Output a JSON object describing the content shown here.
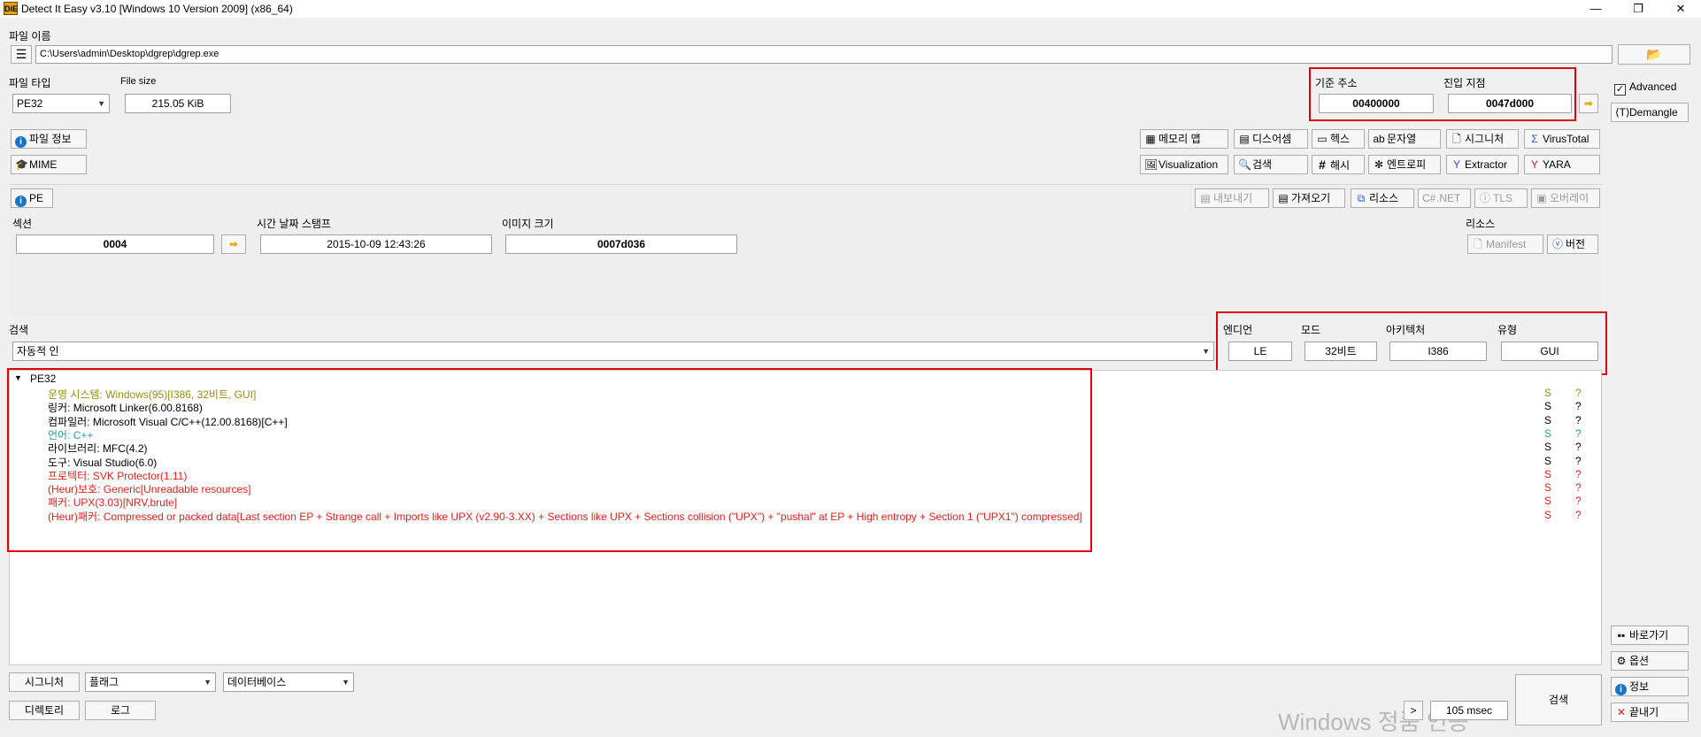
{
  "window": {
    "title": "Detect It Easy v3.10 [Windows 10 Version 2009] (x86_64)",
    "app_icon": "DiE"
  },
  "file": {
    "label": "파일 이름",
    "path": "C:\\Users\\admin\\Desktop\\dgrep\\dgrep.exe"
  },
  "filetype": {
    "label": "파일 타입",
    "value": "PE32"
  },
  "filesize": {
    "label": "File size",
    "value": "215.05 KiB"
  },
  "address": {
    "base_label": "기준 주소",
    "base_value": "00400000",
    "entry_label": "진입 지점",
    "entry_value": "0047d000"
  },
  "side": {
    "advanced": "Advanced",
    "demangle": "Demangle",
    "shortcut": "바로가기",
    "options": "옵션",
    "info": "정보",
    "exit": "끝내기"
  },
  "toolbar": {
    "file_info": "파일 정보",
    "mime": "MIME",
    "memory_map": "메모리 맵",
    "disasm": "디스어셈",
    "hex": "헥스",
    "strings": "문자열",
    "signature": "시그니처",
    "virustotal": "VirusTotal",
    "visualization": "Visualization",
    "search": "검색",
    "hash": "해시",
    "entropy": "엔트로피",
    "extractor": "Extractor",
    "yara": "YARA"
  },
  "pe": {
    "button": "PE",
    "export": "내보내기",
    "import": "가져오기",
    "resource": "리소스",
    "net": ".NET",
    "tls": "TLS",
    "overlay": "오버레이",
    "sections_label": "섹션",
    "sections_value": "0004",
    "timestamp_label": "시간 날짜 스탬프",
    "timestamp_value": "2015-10-09 12:43:26",
    "image_size_label": "이미지 크기",
    "image_size_value": "0007d036",
    "resources_label": "리소스",
    "manifest": "Manifest",
    "version": "버전"
  },
  "scan": {
    "label": "검색",
    "mode": "자동적 인",
    "endian_label": "엔디언",
    "endian_value": "LE",
    "mode_label": "모드",
    "mode_value": "32비트",
    "arch_label": "아키텍처",
    "arch_value": "I386",
    "type_label": "유형",
    "type_value": "GUI"
  },
  "results": {
    "root": "PE32",
    "items": [
      {
        "prefix": "운영 시스템: ",
        "text": "Windows(95)[I386, 32비트, GUI]",
        "color": "#9a8a14",
        "s": "S",
        "q": "?",
        "scolor": "#9a8a14"
      },
      {
        "prefix": "링커: ",
        "text": "Microsoft Linker(6.00.8168)",
        "color": "#000000",
        "s": "S",
        "q": "?",
        "scolor": "#000000"
      },
      {
        "prefix": "컴파일러: ",
        "text": "Microsoft Visual C/C++(12.00.8168)[C++]",
        "color": "#000000",
        "s": "S",
        "q": "?",
        "scolor": "#000000"
      },
      {
        "prefix": "언어: ",
        "text": "C++",
        "color": "#2a9aa0",
        "s": "S",
        "q": "?",
        "scolor": "#2a9aa0"
      },
      {
        "prefix": "라이브러리: ",
        "text": "MFC(4.2)",
        "color": "#000000",
        "s": "S",
        "q": "?",
        "scolor": "#000000"
      },
      {
        "prefix": "도구: ",
        "text": "Visual Studio(6.0)",
        "color": "#000000",
        "s": "S",
        "q": "?",
        "scolor": "#000000"
      },
      {
        "prefix": "프로텍터: ",
        "text": "SVK Protector(1.11)",
        "color": "#e0201c",
        "s": "S",
        "q": "?",
        "scolor": "#e0201c"
      },
      {
        "prefix": "(Heur)보호: ",
        "text": "Generic[Unreadable resources]",
        "color": "#e0201c",
        "s": "S",
        "q": "?",
        "scolor": "#e0201c"
      },
      {
        "prefix": "패커: ",
        "text": "UPX(3.03)[NRV,brute]",
        "color": "#e0201c",
        "s": "S",
        "q": "?",
        "scolor": "#e0201c"
      },
      {
        "prefix": "(Heur)패커: ",
        "text": "Compressed or packed data[Last section EP + Strange call + Imports like UPX (v2.90-3.XX) + Sections like UPX + Sections collision (\"UPX\") + \"pushal\" at EP + High entropy + Section 1 (\"UPX1\") compressed]",
        "color": "#e0201c",
        "s": "S",
        "q": "?",
        "scolor": "#e0201c"
      }
    ]
  },
  "bottom": {
    "signatures": "시그니처",
    "flags": "플래그",
    "database": "데이터베이스",
    "directory": "디렉토리",
    "log": "로그",
    "expand": ">",
    "time": "105 msec",
    "scan_button": "검색"
  },
  "watermark": "Windows 정품 인증"
}
